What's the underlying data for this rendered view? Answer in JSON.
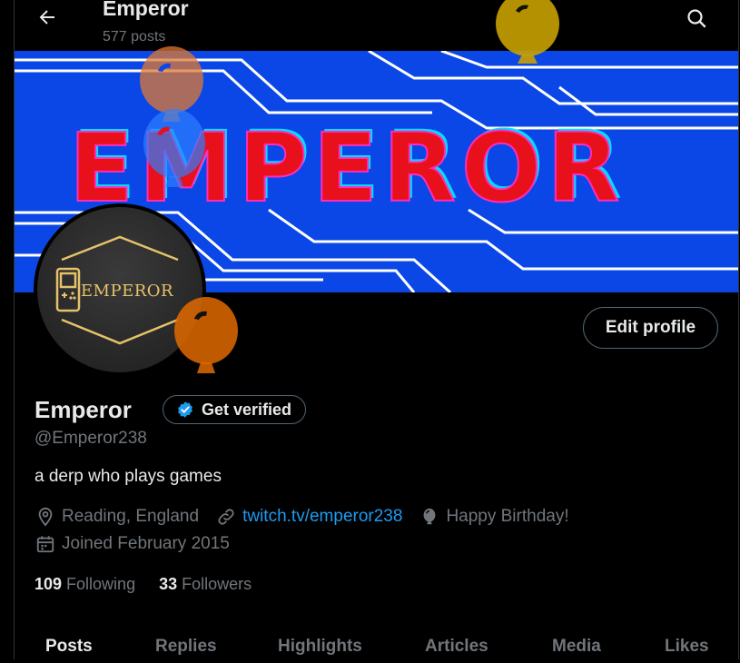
{
  "header": {
    "title": "Emperor",
    "posts_count": "577 posts",
    "back_icon": "arrow-left-icon",
    "search_icon": "search-icon"
  },
  "banner": {
    "text": "EMPEROR",
    "bg_color": "#0a47e6",
    "text_color": "#ff0000"
  },
  "avatar": {
    "text": "EMPEROR",
    "accent": "#e6c26a"
  },
  "profile": {
    "edit_label": "Edit profile",
    "display_name": "Emperor",
    "verify_label": "Get verified",
    "handle": "@Emperor238",
    "bio": "a derp who plays games",
    "location": "Reading, England",
    "website": "twitch.tv/emperor238",
    "birthday": "Happy Birthday!",
    "joined": "Joined February 2015",
    "following_count": "109",
    "following_label": "Following",
    "followers_count": "33",
    "followers_label": "Followers",
    "link_color": "#1d9bf0",
    "verified_color": "#1d9bf0"
  },
  "tabs": [
    {
      "label": "Posts"
    },
    {
      "label": "Replies"
    },
    {
      "label": "Highlights"
    },
    {
      "label": "Articles"
    },
    {
      "label": "Media"
    },
    {
      "label": "Likes"
    }
  ]
}
